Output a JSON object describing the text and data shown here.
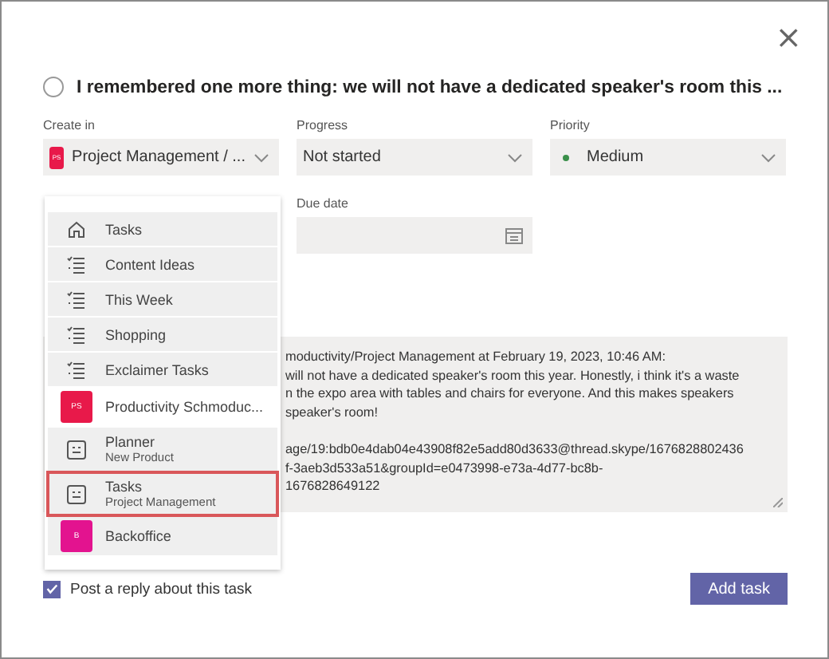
{
  "dialog": {
    "close": "×",
    "title": "I remembered one more thing: we will not have a dedicated speaker's room this ...",
    "completed": false
  },
  "fields": [
    {
      "label": "Create in",
      "value": "Project Management / ...",
      "badge": "PS",
      "color": "#e8194a",
      "kind": "plan"
    },
    {
      "label": "Progress",
      "value": "Not started",
      "kind": "plain"
    },
    {
      "label": "Priority",
      "value": "Medium",
      "kind": "priority",
      "color": "#3a8f4a"
    }
  ],
  "due_date": {
    "label": "Due date"
  },
  "notes": {
    "paragraphs": [
      [
        "moductivity/Project Management at February 19, 2023, 10:46 AM:",
        "will not have a dedicated speaker's room this year. Honestly, i think it's a waste",
        "n the expo area with tables and chairs for everyone. And this makes speakers",
        "speaker's room!"
      ],
      [
        "age/19:bdb0e4dab04e43908f82e5add80d3633@thread.skype/1676828802436",
        "f-3aeb3d533a51&groupId=e0473998-e73a-4d77-bc8b-",
        "1676828649122"
      ]
    ]
  },
  "menu": [
    {
      "kind": "home",
      "label": "Tasks",
      "shaded": true,
      "selected": false
    },
    {
      "kind": "list",
      "label": "Content Ideas",
      "shaded": true,
      "selected": false
    },
    {
      "kind": "list",
      "label": "This Week",
      "shaded": true,
      "selected": false
    },
    {
      "kind": "list",
      "label": "Shopping",
      "shaded": true,
      "selected": false
    },
    {
      "kind": "list",
      "label": "Exclaimer Tasks",
      "shaded": true,
      "selected": false
    },
    {
      "kind": "team",
      "label": "Productivity Schmoduc...",
      "badge": "PS",
      "color": "#e8194a",
      "shaded": false,
      "selected": false
    },
    {
      "kind": "plan",
      "label": "Planner",
      "sublabel": "New Product",
      "shaded": true,
      "selected": false
    },
    {
      "kind": "plan",
      "label": "Tasks",
      "sublabel": "Project Management",
      "shaded": true,
      "selected": true
    },
    {
      "kind": "team",
      "label": "Backoffice",
      "badge": "B",
      "color": "#e3138f",
      "shaded": true,
      "selected": false
    }
  ],
  "post_reply": {
    "label": "Post a reply about this task",
    "checked": true
  },
  "add_button": "Add task"
}
